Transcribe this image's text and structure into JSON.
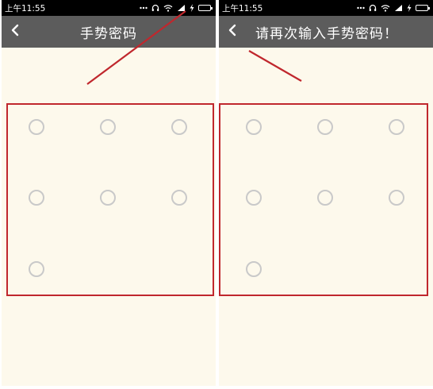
{
  "status_bar": {
    "time": "上午11:55"
  },
  "screens": [
    {
      "title": "手势密码",
      "back_glyph": "‹"
    },
    {
      "title": "请再次输入手势密码！",
      "back_glyph": "‹"
    }
  ],
  "colors": {
    "annotation": "#c0272d",
    "titlebar": "#5c5c5c",
    "background": "#fdf9ec",
    "pattern_dot": "#c9c9c9",
    "battery": "#7fe04a"
  },
  "icons": [
    "back-arrow-icon",
    "headphone-icon",
    "wifi-icon",
    "signal-icon",
    "charging-icon",
    "battery-icon"
  ]
}
